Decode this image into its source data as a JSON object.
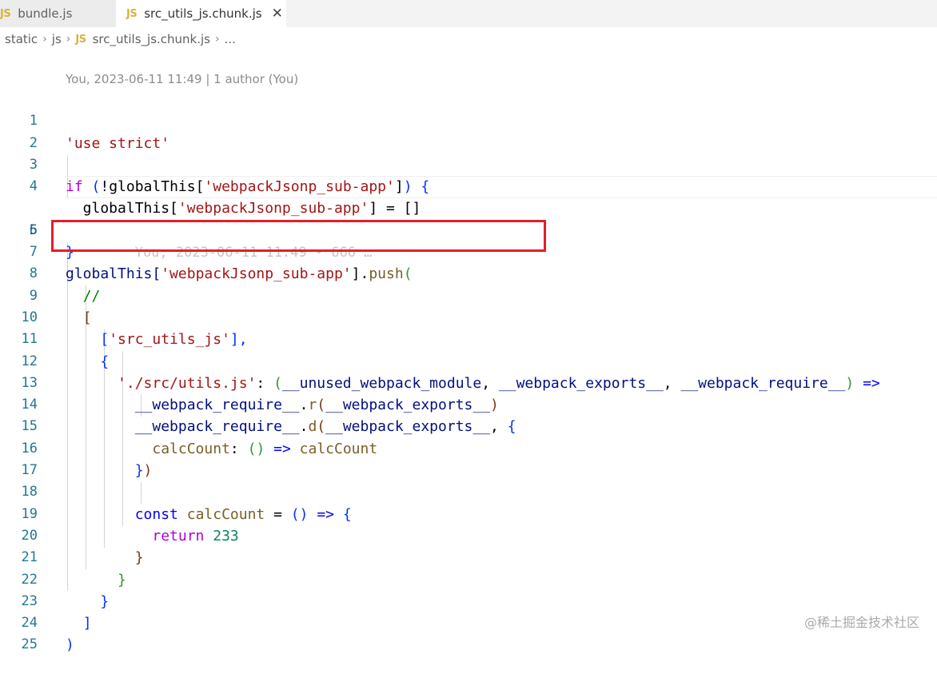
{
  "tabs": [
    {
      "badge": "JS",
      "label": "bundle.js",
      "active": false
    },
    {
      "badge": "JS",
      "label": "src_utils_js.chunk.js",
      "active": true,
      "close": "✕"
    }
  ],
  "breadcrumb": {
    "items": [
      "static",
      "js"
    ],
    "file_badge": "JS",
    "file": "src_utils_js.chunk.js",
    "ellipsis": "...",
    "separator": "›"
  },
  "blame_header": "You, 2023-06-11 11:49 | 1 author (You)",
  "inline_blame": "You, 2023-06-11 11:49 • 666 …",
  "line_numbers": [
    "1",
    "2",
    "3",
    "4",
    "5",
    "6",
    "7",
    "8",
    "9",
    "10",
    "11",
    "12",
    "13",
    "14",
    "15",
    "16",
    "17",
    "18",
    "19",
    "20",
    "21",
    "22",
    "23",
    "24",
    "25"
  ],
  "code": {
    "l1": {
      "str": "'use strict'"
    },
    "l3": {
      "kw": "if",
      "p1": " (",
      "p2": "!globalThis[",
      "s": "'webpackJsonp_sub-app'",
      "p3": "]",
      "p4": ")",
      "p5": " {"
    },
    "l4": {
      "p1": "  globalThis[",
      "s": "'webpackJsonp_sub-app'",
      "p2": "] = []"
    },
    "l5": {
      "p1": "}"
    },
    "l7": {
      "p1": "globalThis[",
      "s": "'webpackJsonp_sub-app'",
      "p2": "].",
      "fn": "push",
      "p3": "("
    },
    "l8": {
      "cmt": "//"
    },
    "l9": {
      "p1": "["
    },
    "l10": {
      "p1": "[",
      "s": "'src_utils_js'",
      "p2": "],"
    },
    "l11": {
      "p1": "{"
    },
    "l12": {
      "s": "'./src/utils.js'",
      "p1": ": ",
      "p2": "(",
      "v1": "__unused_webpack_module",
      "c1": ", ",
      "v2": "__webpack_exports__",
      "c2": ", ",
      "v3": "__webpack_require__",
      "p3": ")",
      "arrow": " =>"
    },
    "l13": {
      "v1": "__webpack_require__",
      "dot": ".",
      "fn": "r",
      "p1": "(",
      "v2": "__webpack_exports__",
      "p2": ")"
    },
    "l14": {
      "v1": "__webpack_require__",
      "dot": ".",
      "fn": "d",
      "p1": "(",
      "v2": "__webpack_exports__",
      "c": ", ",
      "p2": "{"
    },
    "l15": {
      "fn1": "calcCount",
      "c": ": ",
      "p": "()",
      "arrow": " => ",
      "fn2": "calcCount"
    },
    "l16": {
      "p1": "}",
      "p2": ")"
    },
    "l18": {
      "kw": "const",
      "sp": " ",
      "fn": "calcCount",
      "eq": " = ",
      "p": "()",
      "arrow": " => ",
      "b": "{"
    },
    "l19": {
      "kw": "return",
      "sp": " ",
      "num": "233"
    },
    "l20": {
      "b": "}"
    },
    "l21": {
      "b": "}"
    },
    "l22": {
      "b": "}"
    },
    "l23": {
      "b": "]"
    },
    "l24": {
      "b": ")"
    }
  },
  "watermark": "@稀土掘金技术社区",
  "colors": {
    "highlight_box": "#e0202a",
    "js_badge": "#d6b43a",
    "line_number": "#237893"
  }
}
